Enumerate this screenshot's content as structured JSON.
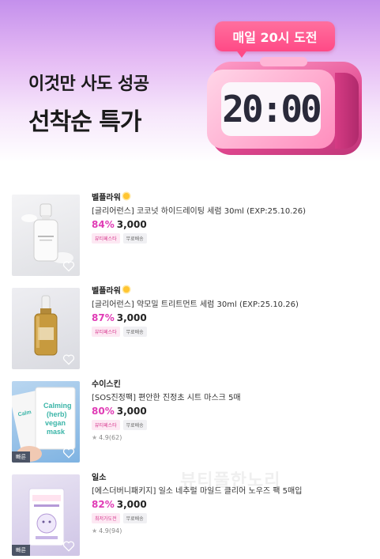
{
  "banner": {
    "line1": "이것만 사도 성공",
    "line2": "선착순 특가",
    "badge": "매일 20시 도전",
    "clock": "20:00"
  },
  "products": [
    {
      "brand": "벨플라워",
      "title": "[글리어런스] 코코넛 하이드레이팅 세럼 30ml (EXP:25.10.26)",
      "discount": "84%",
      "price": "3,000",
      "tags": [
        "뷰티페스타",
        "무료배송"
      ],
      "rating": null
    },
    {
      "brand": "벨플라워",
      "title": "[글리어런스] 약모밀 트리트먼트 세럼 30ml (EXP:25.10.26)",
      "discount": "87%",
      "price": "3,000",
      "tags": [
        "뷰티페스타",
        "무료배송"
      ],
      "rating": null
    },
    {
      "brand": "수이스킨",
      "title": "[SOS진정팩] 편안한 진정초 시트 마스크 5매",
      "discount": "80%",
      "price": "3,000",
      "tags": [
        "뷰티페스타",
        "무료배송"
      ],
      "rating": "4.9(62)",
      "fast": "빠른",
      "mask_text": "Calming (herb) vegan mask"
    },
    {
      "brand": "일소",
      "title": "[에스더버니패키지] 일소 네추럴 마일드 클리어 노우즈 팩 5매입",
      "discount": "82%",
      "price": "3,000",
      "tags": [
        "최저가도전",
        "무료배송"
      ],
      "rating": "4.9(94)",
      "fast": "빠른"
    }
  ],
  "watermark": "뷰티풀한노리",
  "colors": {
    "accent": "#e03bb5",
    "badge": "#ff4a86",
    "tag_pink": "#d6378e"
  }
}
